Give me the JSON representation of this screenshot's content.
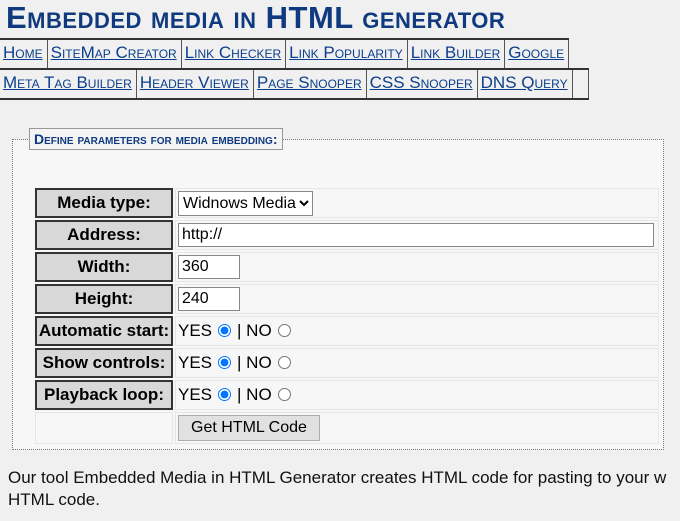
{
  "title": "Embedded media in HTML generator",
  "nav1": [
    "Home",
    "SiteMap Creator",
    "Link Checker",
    "Link Popularity",
    "Link Builder",
    "Google"
  ],
  "nav2": [
    "Meta Tag Builder",
    "Header Viewer",
    "Page Snooper",
    "CSS Snooper",
    "DNS Query",
    ""
  ],
  "form": {
    "legend": "Define parameters for media embedding:",
    "media_label": "Media type:",
    "media_value": "Widnows Media",
    "address_label": "Address:",
    "address_value": "http://",
    "width_label": "Width:",
    "width_value": "360",
    "height_label": "Height:",
    "height_value": "240",
    "autostart_label": "Automatic start:",
    "controls_label": "Show controls:",
    "loop_label": "Playback loop:",
    "yes": "YES",
    "no": "| NO",
    "submit": "Get HTML Code"
  },
  "description": [
    "Our tool Embedded Media in HTML Generator creates HTML code for pasting to your w",
    "HTML code."
  ]
}
